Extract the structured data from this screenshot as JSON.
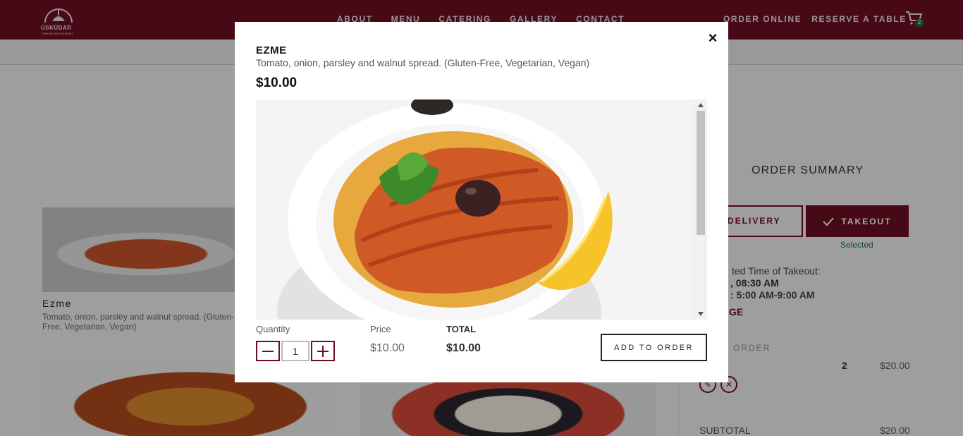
{
  "header": {
    "logo_text": "ÜSKÜDAR",
    "logo_sub": "TURKISH RESTAURANT",
    "nav": [
      "ABOUT",
      "MENU",
      "CATERING",
      "GALLERY",
      "CONTACT"
    ],
    "order_online": "ORDER ONLINE",
    "reserve": "RESERVE A TABLE",
    "cart_count": "2"
  },
  "menu_card": {
    "title": "Ezme",
    "description": "Tomato, onion, parsley and walnut spread. (Gluten-Free, Vegetarian, Vegan)"
  },
  "summary": {
    "title": "ORDER SUMMARY",
    "delivery": "DELIVERY",
    "takeout": "TAKEOUT",
    "selected": "Selected",
    "time_label": "ted Time of Takeout:",
    "time_value": ", 08:30 AM",
    "hours": ": 5:00 AM-9:00 AM",
    "change": "GE",
    "order_caption": "ORDER",
    "qty": "2",
    "line_price": "$20.00",
    "subtotal_label": "SUBTOTAL",
    "subtotal_value": "$20.00"
  },
  "modal": {
    "title": "EZME",
    "description": "Tomato, onion, parsley and walnut spread. (Gluten-Free, Vegetarian, Vegan)",
    "price": "$10.00",
    "quantity_label": "Quantity",
    "quantity_value": "1",
    "price_label": "Price",
    "price_value": "$10.00",
    "total_label": "TOTAL",
    "total_value": "$10.00",
    "add_button": "ADD TO ORDER",
    "close": "×"
  },
  "colors": {
    "brand": "#6d0f23",
    "selected_green": "#1d7a3a"
  }
}
